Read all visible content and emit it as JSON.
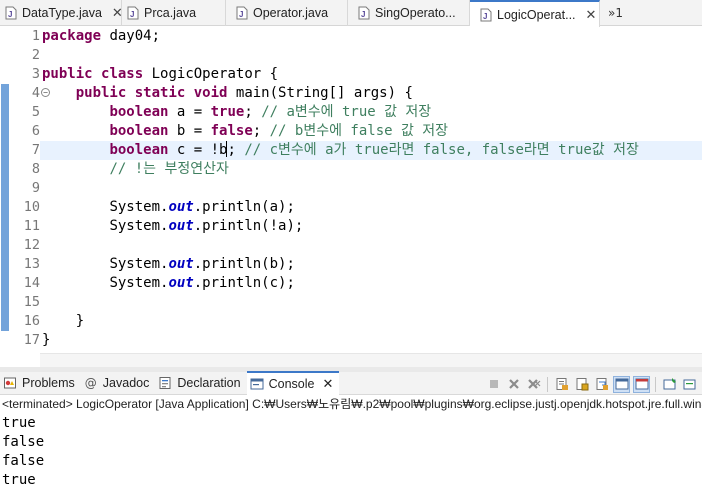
{
  "tabs": [
    {
      "label": "DataType.java",
      "active": false,
      "closable": true
    },
    {
      "label": "Prca.java",
      "active": false,
      "closable": false
    },
    {
      "label": "Operator.java",
      "active": false,
      "closable": false
    },
    {
      "label": "SingOperato...",
      "active": false,
      "closable": false
    },
    {
      "label": "LogicOperat...",
      "active": true,
      "closable": true
    }
  ],
  "tab_overflow": "»1",
  "editor": {
    "line_numbers": [
      "1",
      "2",
      "3",
      "4",
      "5",
      "6",
      "7",
      "8",
      "9",
      "10",
      "11",
      "12",
      "13",
      "14",
      "15",
      "16",
      "17"
    ],
    "current_line": 7,
    "code": {
      "l1_kw": "package",
      "l1_rest": " day04;",
      "l3_kw1": "public",
      "l3_kw2": "class",
      "l3_rest": " LogicOperator {",
      "l4_kw1": "public",
      "l4_kw2": "static",
      "l4_kw3": "void",
      "l4_rest": " main(String[] args) {",
      "l5_kw": "boolean",
      "l5_mid": " a = ",
      "l5_lit": "true",
      "l5_semi": "; ",
      "l5_cm": "// a변수에 true 값 저장",
      "l6_kw": "boolean",
      "l6_mid": " b = ",
      "l6_lit": "false",
      "l6_semi": "; ",
      "l6_cm": "// b변수에 false 값 저장",
      "l7_kw": "boolean",
      "l7_mid": " c = !b",
      "l7_semi": "; ",
      "l7_cm": "// c변수에 a가 true라면 false, false라면 true값 저장",
      "l8_cm": "// !는 부정연산자",
      "l10_a": "System.",
      "l10_f": "out",
      "l10_b": ".println(a);",
      "l11_a": "System.",
      "l11_f": "out",
      "l11_b": ".println(!a);",
      "l13_a": "System.",
      "l13_f": "out",
      "l13_b": ".println(b);",
      "l14_a": "System.",
      "l14_f": "out",
      "l14_b": ".println(c);",
      "l16": "}",
      "l17": "}"
    }
  },
  "views": [
    {
      "label": "Problems",
      "icon": "problems-icon",
      "active": false
    },
    {
      "label": "Javadoc",
      "icon": "javadoc-icon",
      "active": false
    },
    {
      "label": "Declaration",
      "icon": "declaration-icon",
      "active": false
    },
    {
      "label": "Console",
      "icon": "console-icon",
      "active": true
    }
  ],
  "console": {
    "status": "<terminated> LogicOperator [Java Application] C:₩Users₩노유림₩.p2₩pool₩plugins₩org.eclipse.justj.openjdk.hotspot.jre.full.win32",
    "output": [
      "true",
      "false",
      "false",
      "true"
    ]
  },
  "colors": {
    "keyword": "#7f0055",
    "comment": "#3f7f5f",
    "static_field": "#0000c0",
    "active_tab_border": "#3c78c8",
    "current_line": "#e8f2fe"
  }
}
